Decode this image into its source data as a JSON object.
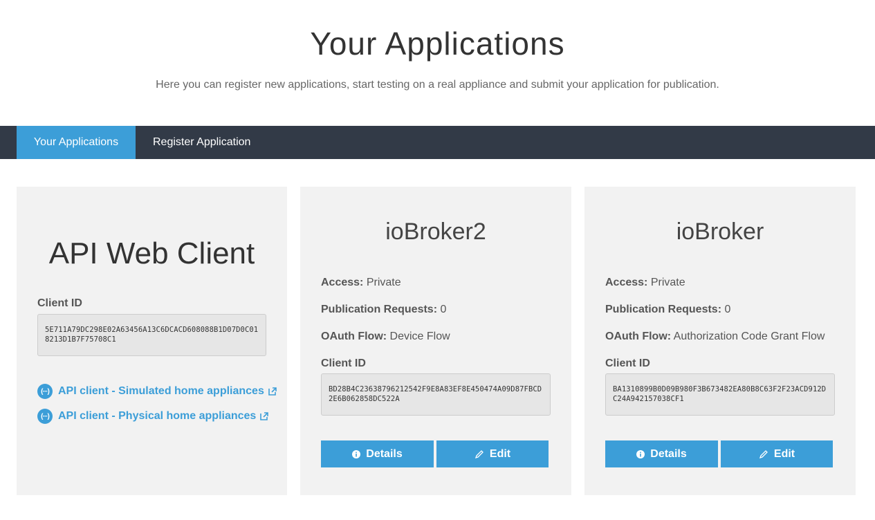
{
  "header": {
    "title": "Your Applications",
    "subtitle": "Here you can register new applications, start testing on a real appliance and submit your application for publication."
  },
  "nav": {
    "tabs": [
      {
        "label": "Your Applications",
        "active": true
      },
      {
        "label": "Register Application",
        "active": false
      }
    ]
  },
  "api_card": {
    "title": "API Web Client",
    "client_id_label": "Client ID",
    "client_id": "5E711A79DC298E02A63456A13C6DCACD608088B1D07D0C018213D1B7F75708C1",
    "links": [
      {
        "label": "API client - Simulated home appliances",
        "icon": "api-icon"
      },
      {
        "label": "API client - Physical home appliances",
        "icon": "api-icon"
      }
    ]
  },
  "apps": [
    {
      "name": "ioBroker2",
      "access_label": "Access:",
      "access": "Private",
      "pub_label": "Publication Requests:",
      "pub_requests": "0",
      "oauth_label": "OAuth Flow:",
      "oauth_flow": "Device Flow",
      "client_id_label": "Client ID",
      "client_id": "BD28B4C23638796212542F9E8A83EF8E450474A09D87FBCD2E6B062858DC522A",
      "details_label": "Details",
      "edit_label": "Edit"
    },
    {
      "name": "ioBroker",
      "access_label": "Access:",
      "access": "Private",
      "pub_label": "Publication Requests:",
      "pub_requests": "0",
      "oauth_label": "OAuth Flow:",
      "oauth_flow": "Authorization Code Grant Flow",
      "client_id_label": "Client ID",
      "client_id": "BA1310899B0D09B980F3B673482EA80B8C63F2F23ACD912DC24A942157038CF1",
      "details_label": "Details",
      "edit_label": "Edit"
    }
  ],
  "colors": {
    "accent": "#3c9ed8",
    "navbar": "#323a47",
    "card_bg": "#f2f2f2"
  }
}
